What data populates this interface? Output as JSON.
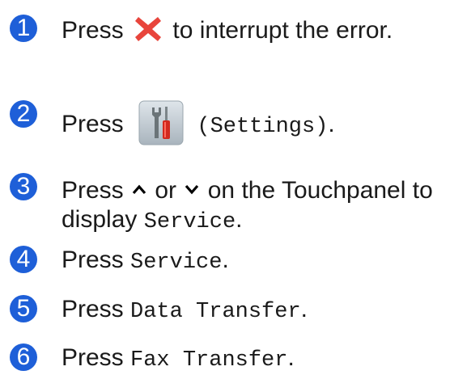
{
  "steps": [
    {
      "number": "1",
      "before": "Press",
      "icon": "cancel-x-icon",
      "after": "to interrupt the error."
    },
    {
      "number": "2",
      "before": "Press",
      "icon": "settings-icon",
      "code": "(Settings)",
      "after": "."
    },
    {
      "number": "3",
      "before": "Press",
      "icon_up": "chevron-up-icon",
      "middle": "or",
      "icon_down": "chevron-down-icon",
      "after": "on the Touchpanel to",
      "line2_before": "display",
      "code": "Service",
      "line2_after": "."
    },
    {
      "number": "4",
      "before": "Press",
      "code": "Service",
      "after": "."
    },
    {
      "number": "5",
      "before": "Press",
      "code": "Data Transfer",
      "after": "."
    },
    {
      "number": "6",
      "before": "Press",
      "code": "Fax Transfer",
      "after": "."
    }
  ],
  "colors": {
    "step_badge": "#1e5fd8",
    "cancel_icon": "#e8453c",
    "text": "#1a1a1a"
  }
}
